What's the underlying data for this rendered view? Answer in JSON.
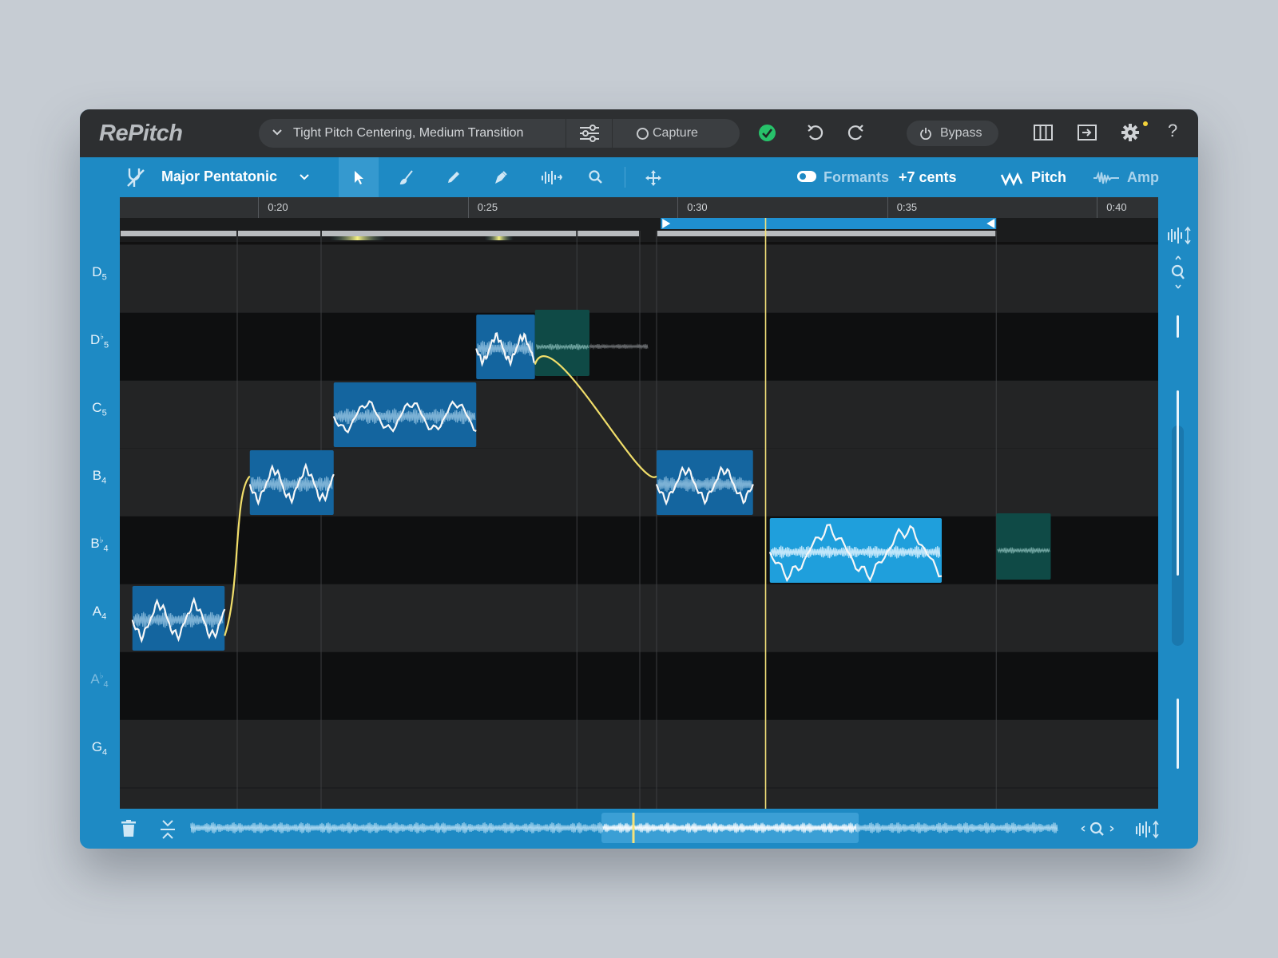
{
  "app": {
    "title": "RePitch"
  },
  "preset": {
    "name": "Tight Pitch Centering, Medium Transition",
    "capture_label": "Capture"
  },
  "top_actions": {
    "bypass_label": "Bypass",
    "help_label": "?"
  },
  "toolbar": {
    "scale": "Major Pentatonic",
    "tools": [
      "select-arrow-icon",
      "smooth-brush-icon",
      "pencil-icon",
      "pen-nib-icon",
      "waveform-pitch-icon",
      "zoom-icon",
      "move-arrows-icon"
    ],
    "active_tool": "select-arrow-icon",
    "formants_label": "Formants",
    "formants_value": "+7 cents",
    "pitch_label": "Pitch",
    "amp_label": "Amp"
  },
  "timeline": {
    "ticks": [
      "0:20",
      "0:25",
      "0:30",
      "0:35",
      "0:40"
    ]
  },
  "keyboard": {
    "notes": [
      {
        "name": "D",
        "sub": "5",
        "flat": false,
        "dim": false
      },
      {
        "name": "D",
        "sub": "5",
        "flat": true,
        "dim": false
      },
      {
        "name": "C",
        "sub": "5",
        "flat": false,
        "dim": false
      },
      {
        "name": "B",
        "sub": "4",
        "flat": false,
        "dim": false
      },
      {
        "name": "B",
        "sub": "4",
        "flat": true,
        "dim": false
      },
      {
        "name": "A",
        "sub": "4",
        "flat": false,
        "dim": false
      },
      {
        "name": "A",
        "sub": "4",
        "flat": true,
        "dim": true
      },
      {
        "name": "G",
        "sub": "4",
        "flat": false,
        "dim": false
      }
    ]
  },
  "notes_blobs": [
    {
      "note": "A4",
      "start": "0:17.0",
      "end": "0:19.2"
    },
    {
      "note": "B4",
      "start": "0:19.8",
      "end": "0:21.8"
    },
    {
      "note": "C5",
      "start": "0:21.8",
      "end": "0:25.2"
    },
    {
      "note": "D♭5",
      "start": "0:25.2",
      "end": "0:26.6"
    },
    {
      "note": "B4",
      "start": "0:29.5",
      "end": "0:31.8"
    },
    {
      "note": "B♭4",
      "start": "0:32.2",
      "end": "0:36.3"
    }
  ],
  "selection": {
    "start": "0:29.6",
    "end": "0:37.6"
  },
  "playhead": "0:32.1",
  "colors": {
    "accent": "#1e8ac4",
    "playhead": "#f4e27a",
    "note": "#14659f",
    "note_selected": "#1f9fdc",
    "note_tail": "#0f4a46",
    "check": "#27c26a"
  }
}
